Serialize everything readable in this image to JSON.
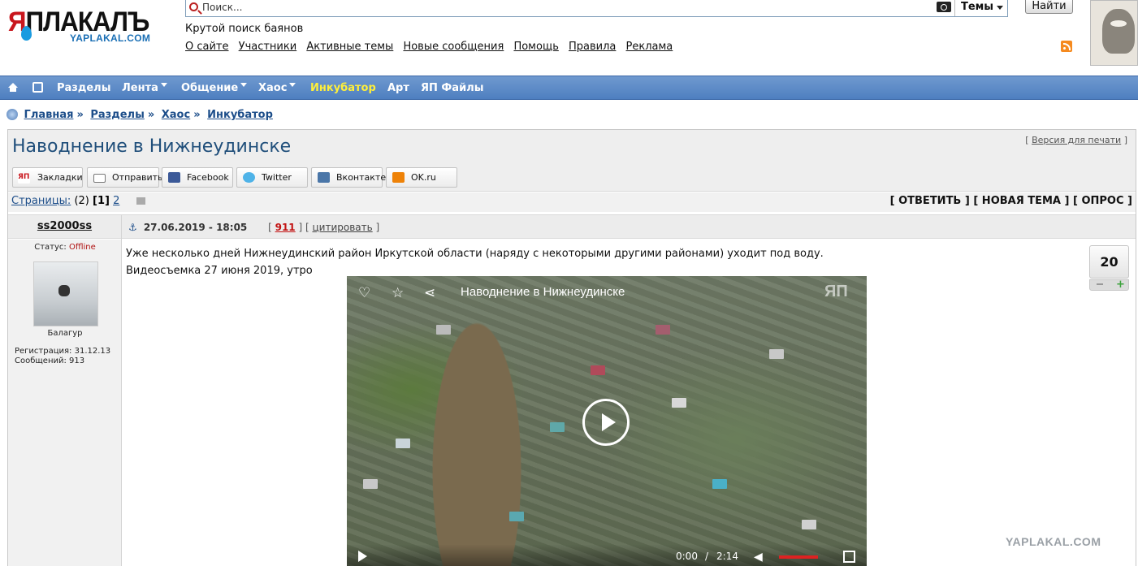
{
  "logo": {
    "main_red": "Я",
    "main_black": "ПЛАКАЛЪ",
    "sub": "YAPLAKAL.COM"
  },
  "search": {
    "placeholder": "Поиск...",
    "scope_label": "Темы",
    "find_label": "Найти"
  },
  "tagline": "Крутой поиск баянов",
  "top_nav": [
    "О сайте",
    "Участники",
    "Активные темы",
    "Новые сообщения",
    "Помощь",
    "Правила",
    "Реклама"
  ],
  "main_nav": {
    "items": [
      {
        "label": "Разделы",
        "dropdown": false,
        "highlight": false
      },
      {
        "label": "Лента",
        "dropdown": true,
        "highlight": false
      },
      {
        "label": "Общение",
        "dropdown": true,
        "highlight": false
      },
      {
        "label": "Хаос",
        "dropdown": true,
        "highlight": false
      },
      {
        "label": "Инкубатор",
        "dropdown": false,
        "highlight": true
      },
      {
        "label": "Арт",
        "dropdown": false,
        "highlight": false
      },
      {
        "label": "ЯП Файлы",
        "dropdown": false,
        "highlight": false
      }
    ],
    "highlight_color": "#ffef3a"
  },
  "breadcrumb": [
    "Главная",
    "Разделы",
    "Хаос",
    "Инкубатор"
  ],
  "breadcrumb_sep": "»",
  "topic": {
    "title": "Наводнение в Нижнеудинске",
    "print_link": "Версия для печати"
  },
  "share": [
    {
      "label": "Закладки",
      "icon": "yap-bookmark-icon"
    },
    {
      "label": "Отправить",
      "icon": "mail-icon"
    },
    {
      "label": "Facebook",
      "icon": "facebook-icon"
    },
    {
      "label": "Twitter",
      "icon": "twitter-icon"
    },
    {
      "label": "Вконтакте",
      "icon": "vk-icon"
    },
    {
      "label": "OK.ru",
      "icon": "ok-icon"
    }
  ],
  "pages": {
    "label": "Страницы:",
    "total": "(2)",
    "current": "[1]",
    "next": "2"
  },
  "actions": {
    "reply": "[ ОТВЕТИТЬ ]",
    "new_topic": "[ НОВАЯ ТЕМА ]",
    "poll": "[ ОПРОС ]"
  },
  "post": {
    "author": "ss2000ss",
    "date": "27.06.2019 - 18:05",
    "number": "911",
    "quote_label": "цитировать",
    "status_label": "Статус:",
    "status_value": "Offline",
    "rank": "Балагур",
    "registration": "Регистрация: 31.12.13",
    "messages": "Сообщений: 913",
    "text_line1": "Уже несколько дней Нижнеудинский район Иркутской области (наряду с некоторыми другими районами) уходит под воду.",
    "text_line2": "Видеосъемка 27 июня 2019, утро",
    "rating": "20"
  },
  "video": {
    "title": "Наводнение в Нижнеудинске",
    "watermark": "ЯП",
    "time_current": "0:00",
    "time_sep": "/",
    "time_total": "2:14",
    "progress": 0,
    "volume_color": "#dd2222"
  },
  "site_watermark": "YAPLAKAL.COM"
}
